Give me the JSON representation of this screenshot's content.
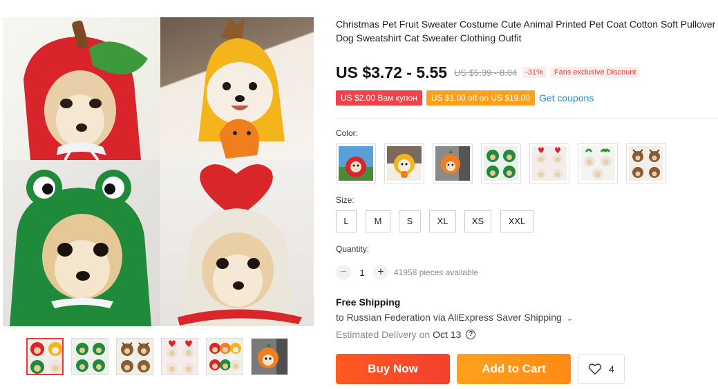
{
  "product": {
    "title": "Christmas Pet Fruit Sweater Costume Cute Animal Printed Pet Coat Cotton Soft Pullover Dog Sweatshirt Cat Sweater Clothing Outfit"
  },
  "price": {
    "current": "US $3.72 - 5.55",
    "original": "US $5.39 - 8.04",
    "discount": "-31%",
    "promo_tag": "Fans exclusive Discount"
  },
  "coupons": [
    {
      "label": "US $2.00 Вам купон"
    },
    {
      "label": "US $1.00 off on US $19.00"
    }
  ],
  "get_coupons_label": "Get coupons",
  "color": {
    "label": "Color:",
    "options": [
      {
        "name": "red-apple"
      },
      {
        "name": "yellow-pear"
      },
      {
        "name": "orange-carrot"
      },
      {
        "name": "green-frog"
      },
      {
        "name": "red-heart"
      },
      {
        "name": "white-sprout"
      },
      {
        "name": "brown-reindeer"
      }
    ]
  },
  "size": {
    "label": "Size:",
    "options": [
      "L",
      "M",
      "S",
      "XL",
      "XS",
      "XXL"
    ]
  },
  "quantity": {
    "label": "Quantity:",
    "minus": "−",
    "value": "1",
    "plus": "+",
    "available": "41958 pieces available"
  },
  "shipping": {
    "title": "Free Shipping",
    "destination": "to Russian Federation via AliExpress Saver Shipping",
    "estimated_label": "Estimated Delivery on",
    "estimated_date": "Oct 13"
  },
  "actions": {
    "buy_now": "Buy Now",
    "add_to_cart": "Add to Cart",
    "wishlist_count": "4"
  },
  "colors": {
    "price_red": "#f0392b",
    "coupon_red": "#f0424b",
    "coupon_orange": "#ff9f1a",
    "link_blue": "#2e87c8",
    "buy_now": "#f43f2d",
    "add_to_cart": "#ff8a14"
  }
}
